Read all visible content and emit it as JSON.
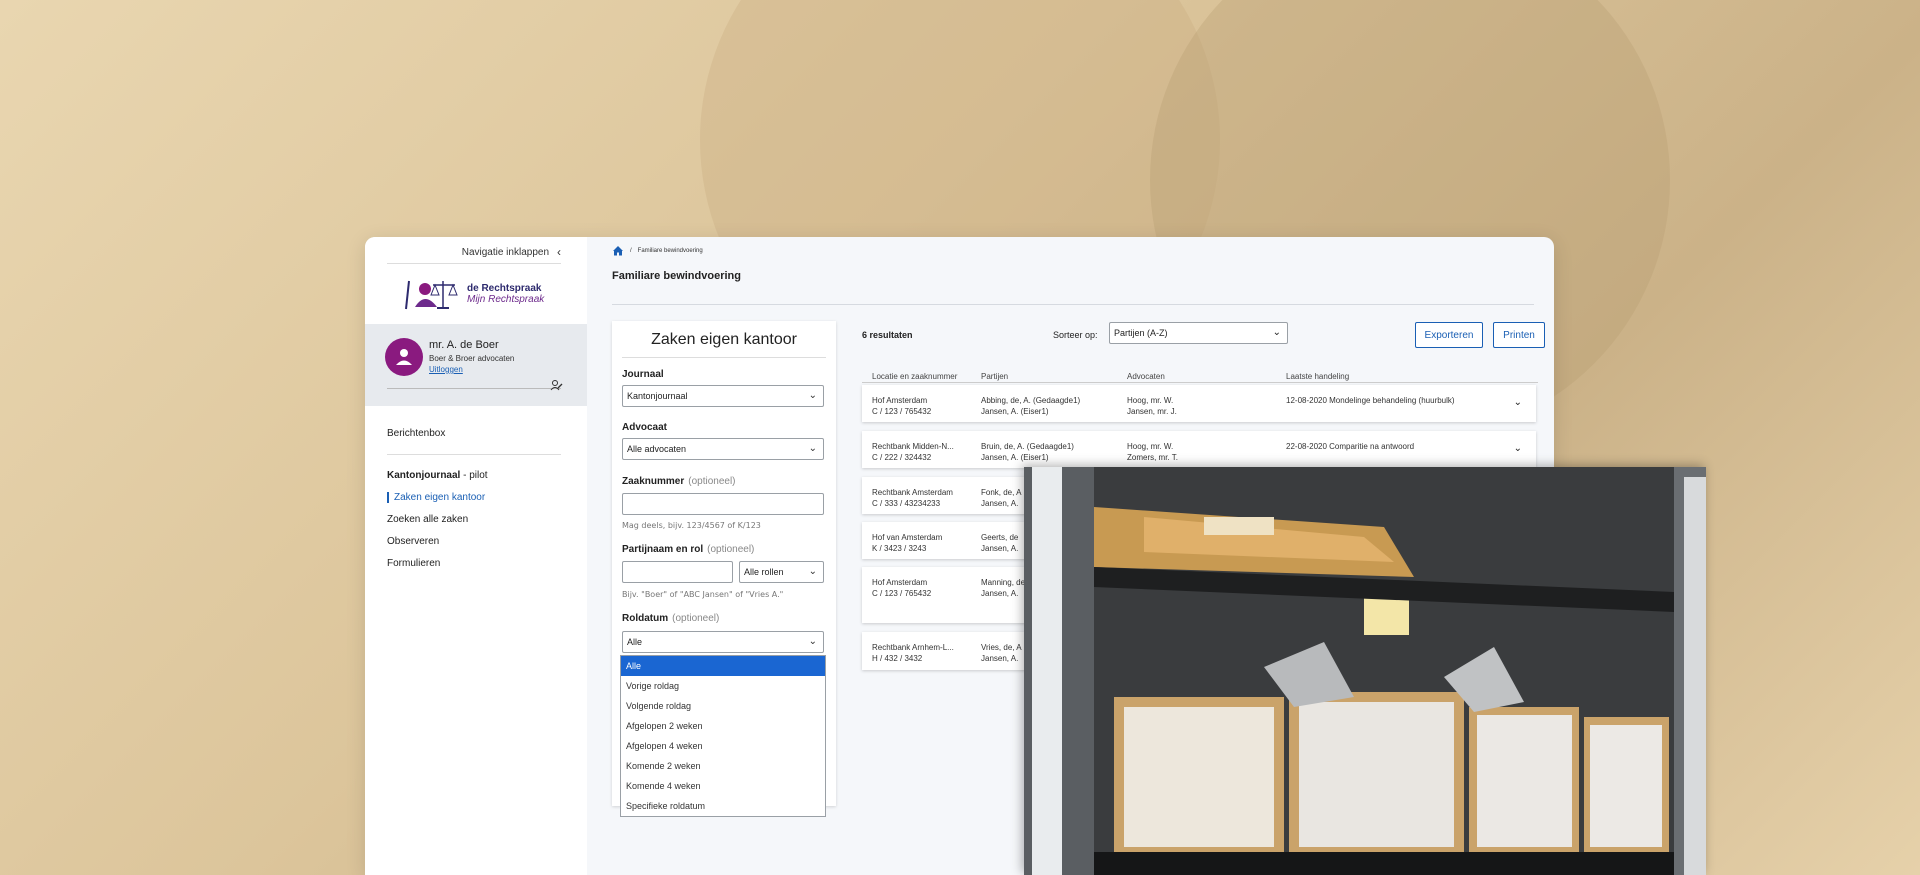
{
  "sidebar": {
    "collapse_label": "Navigatie inklappen",
    "logo_line1": "de Rechtspraak",
    "logo_line2": "Mijn Rechtspraak",
    "user": {
      "name": "mr. A. de Boer",
      "firm": "Boer & Broer advocaten",
      "logout": "Uitloggen"
    },
    "inbox": "Berichtenbox",
    "section_title": "Kantonjournaal",
    "section_suffix": " - pilot",
    "items": [
      "Zaken eigen kantoor",
      "Zoeken alle zaken",
      "Observeren",
      "Formulieren"
    ]
  },
  "breadcrumb": {
    "current": "Familiare bewindvoering"
  },
  "page_title": "Familiare bewindvoering",
  "filter": {
    "title": "Zaken eigen kantoor",
    "journaal_label": "Journaal",
    "journaal_value": "Kantonjournaal",
    "advocaat_label": "Advocaat",
    "advocaat_value": "Alle advocaten",
    "zaaknummer_label": "Zaaknummer",
    "optional": "(optioneel)",
    "zaaknummer_hint": "Mag deels, bijv. 123/4567 of K/123",
    "partij_label": "Partijnaam en rol",
    "partij_role_value": "Alle rollen",
    "partij_hint": "Bijv. \"Boer\" of \"ABC Jansen\" of \"Vries A.\"",
    "roldatum_label": "Roldatum",
    "roldatum_value": "Alle",
    "roldatum_options": [
      "Alle",
      "Vorige roldag",
      "Volgende roldag",
      "Afgelopen 2 weken",
      "Afgelopen 4 weken",
      "Komende 2 weken",
      "Komende 4 weken",
      "Specifieke roldatum"
    ]
  },
  "results": {
    "count": "6 resultaten",
    "sort_label": "Sorteer op:",
    "sort_value": "Partijen (A-Z)",
    "export": "Exporteren",
    "print": "Printen",
    "columns": [
      "Locatie en zaaknummer",
      "Partijen",
      "Advocaten",
      "Laatste handeling"
    ],
    "rows": [
      {
        "loc": "Hof Amsterdam",
        "num": "C / 123 / 765432",
        "p1": "Abbing, de, A. (Gedaagde1)",
        "p2": "Jansen, A. (Eiser1)",
        "a1": "Hoog, mr. W.",
        "a2": "Jansen, mr. J.",
        "last": "12-08-2020 Mondelinge behandeling (huurbulk)"
      },
      {
        "loc": "Rechtbank Midden-N...",
        "num": "C / 222 / 324432",
        "p1": "Bruin, de, A. (Gedaagde1)",
        "p2": "Jansen, A. (Eiser1)",
        "a1": "Hoog, mr. W.",
        "a2": "Zomers, mr. T.",
        "last": "22-08-2020 Comparitie na antwoord"
      },
      {
        "loc": "Rechtbank Amsterdam",
        "num": "C / 333 / 43234233",
        "p1": "Fonk, de, A",
        "p2": "Jansen, A.",
        "a1": "",
        "a2": "",
        "last": ""
      },
      {
        "loc": "Hof van Amsterdam",
        "num": "K / 3423 / 3243",
        "p1": "Geerts, de",
        "p2": "Jansen, A.",
        "a1": "",
        "a2": "",
        "last": ""
      },
      {
        "loc": "Hof Amsterdam",
        "num": "C / 123 / 765432",
        "p1": "Manning, de",
        "p2": "Jansen, A.",
        "a1": "",
        "a2": "",
        "last": ""
      },
      {
        "loc": "Rechtbank Arnhem-L...",
        "num": "H / 432 / 3432",
        "p1": "Vries, de, A",
        "p2": "Jansen, A.",
        "a1": "",
        "a2": "",
        "last": ""
      }
    ]
  },
  "colors": {
    "accent": "#1a5fb4",
    "avatar": "#8a1a7f",
    "selected": "#1a66d2"
  }
}
